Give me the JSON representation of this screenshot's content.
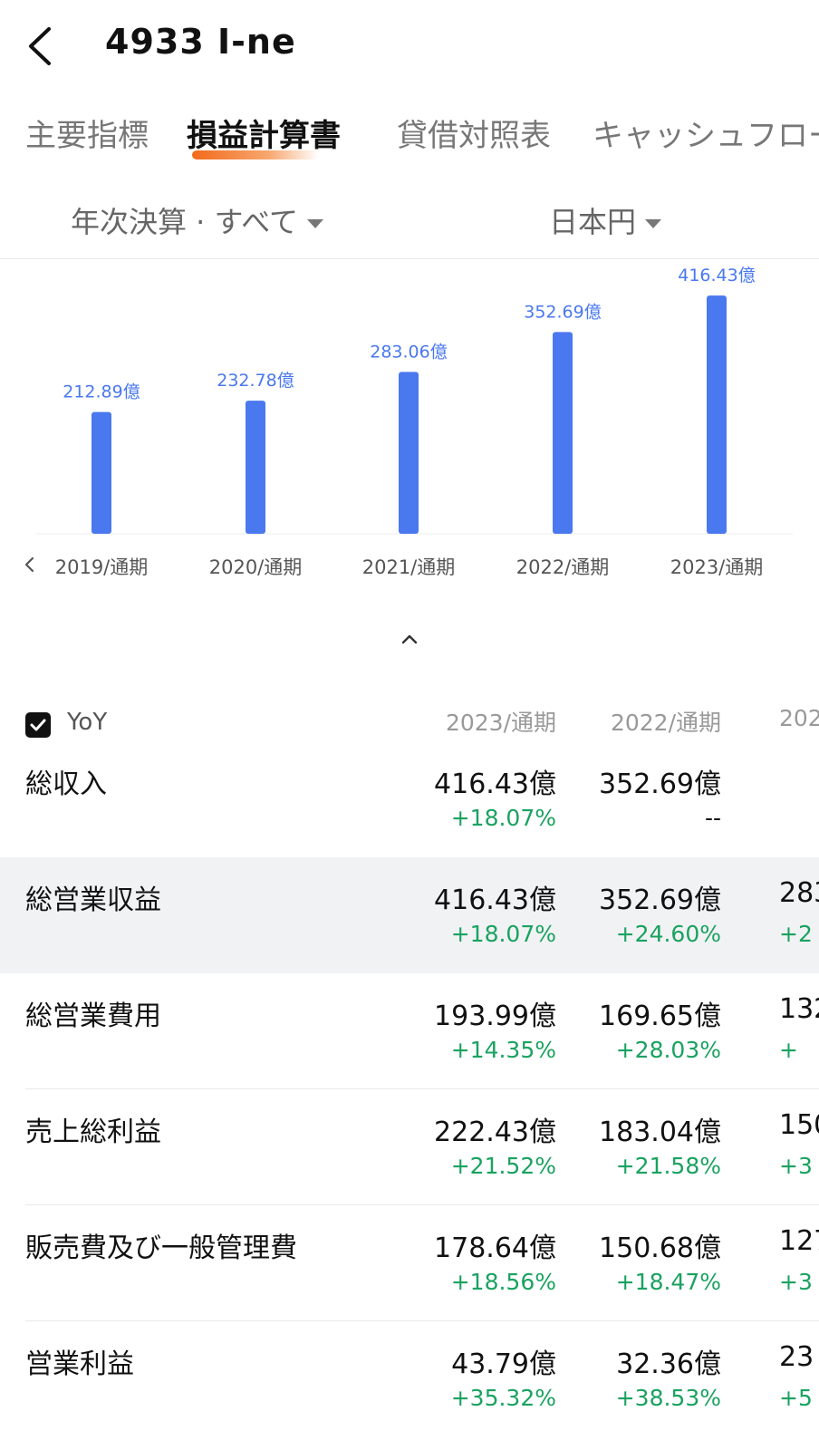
{
  "header": {
    "title": "4933  I-ne",
    "back_icon": "chevron-left-icon"
  },
  "tabs": [
    {
      "label": "主要指標",
      "active": false
    },
    {
      "label": "損益計算書",
      "active": true
    },
    {
      "label": "貸借対照表",
      "active": false
    },
    {
      "label": "キャッシュフロー",
      "active": false
    }
  ],
  "filters": {
    "period": "年次決算 · すべて",
    "currency": "日本円"
  },
  "chart_data": {
    "type": "bar",
    "categories": [
      "2019/通期",
      "2020/通期",
      "2021/通期",
      "2022/通期",
      "2023/通期"
    ],
    "values": [
      212.89,
      232.78,
      283.06,
      352.69,
      416.43
    ],
    "data_labels": [
      "212.89億",
      "232.78億",
      "283.06億",
      "352.69億",
      "416.43億"
    ],
    "unit": "億",
    "ylim": [
      0,
      450
    ],
    "color": "#4a78ef",
    "grid": false
  },
  "chart_controls": {
    "prev_icon": "chevron-left-icon",
    "collapse_icon": "chevron-up-icon"
  },
  "table": {
    "yoy_label": "YoY",
    "yoy_checked": true,
    "columns": [
      "2023/通期",
      "2022/通期",
      "202"
    ],
    "rows": [
      {
        "label": "総収入",
        "cells": [
          {
            "value": "416.43億",
            "pct": "+18.07%"
          },
          {
            "value": "352.69億",
            "pct": "--"
          },
          {
            "value": "",
            "pct": ""
          }
        ]
      },
      {
        "label": "総営業収益",
        "cells": [
          {
            "value": "416.43億",
            "pct": "+18.07%"
          },
          {
            "value": "352.69億",
            "pct": "+24.60%"
          },
          {
            "value": "283",
            "pct": "+2"
          }
        ]
      },
      {
        "label": "総営業費用",
        "cells": [
          {
            "value": "193.99億",
            "pct": "+14.35%"
          },
          {
            "value": "169.65億",
            "pct": "+28.03%"
          },
          {
            "value": "132",
            "pct": "+"
          }
        ]
      },
      {
        "label": "売上総利益",
        "cells": [
          {
            "value": "222.43億",
            "pct": "+21.52%"
          },
          {
            "value": "183.04億",
            "pct": "+21.58%"
          },
          {
            "value": "150",
            "pct": "+3"
          }
        ]
      },
      {
        "label": "販売費及び一般管理費",
        "cells": [
          {
            "value": "178.64億",
            "pct": "+18.56%"
          },
          {
            "value": "150.68億",
            "pct": "+18.47%"
          },
          {
            "value": "127",
            "pct": "+3"
          }
        ]
      },
      {
        "label": "営業利益",
        "cells": [
          {
            "value": "43.79億",
            "pct": "+35.32%"
          },
          {
            "value": "32.36億",
            "pct": "+38.53%"
          },
          {
            "value": "23",
            "pct": "+5"
          }
        ]
      }
    ]
  },
  "colors": {
    "accent_orange": "#f26a1b",
    "bar_blue": "#4a78ef",
    "positive_green": "#1aa260"
  }
}
